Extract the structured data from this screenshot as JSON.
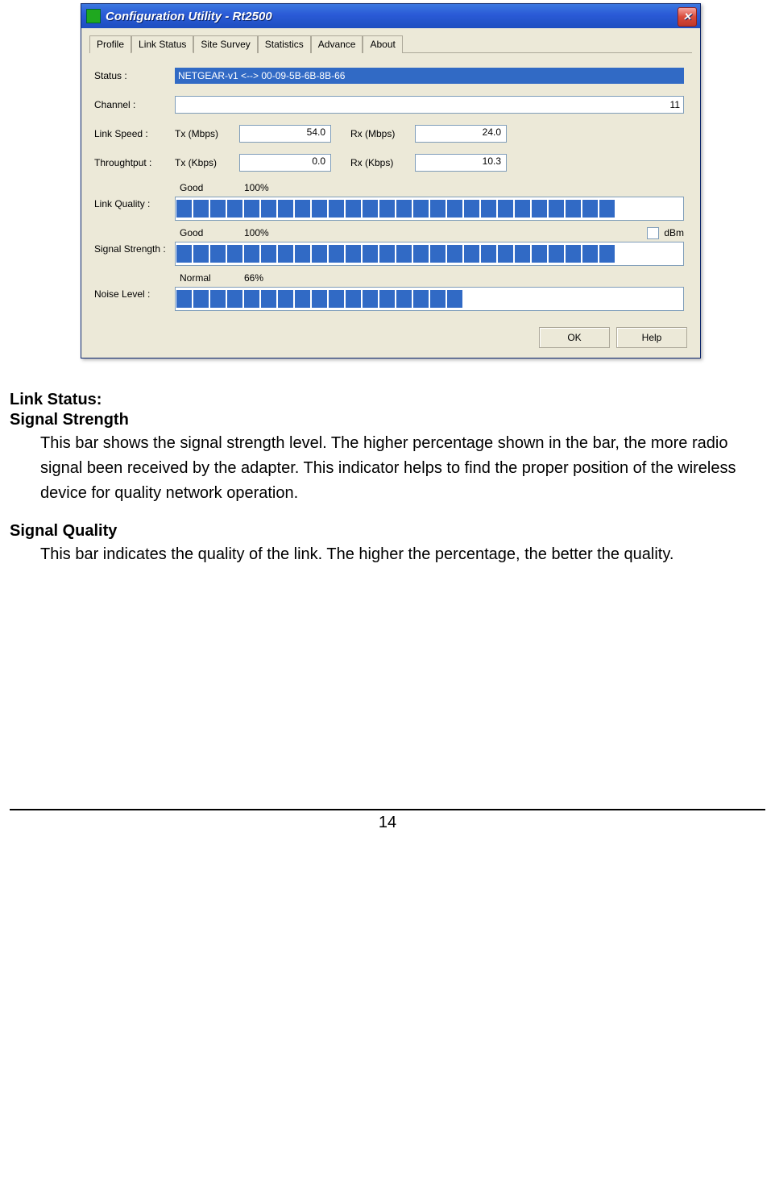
{
  "window": {
    "title": "Configuration Utility - Rt2500",
    "close_glyph": "✕"
  },
  "tabs": [
    "Profile",
    "Link Status",
    "Site Survey",
    "Statistics",
    "Advance",
    "About"
  ],
  "active_tab": 1,
  "fields": {
    "status_label": "Status :",
    "status_value": "NETGEAR-v1 <--> 00-09-5B-6B-8B-66",
    "channel_label": "Channel :",
    "channel_value": "11",
    "linkspeed_label": "Link Speed :",
    "throughput_label": "Throughtput :",
    "tx_mbps_label": "Tx (Mbps)",
    "rx_mbps_label": "Rx (Mbps)",
    "tx_kbps_label": "Tx (Kbps)",
    "rx_kbps_label": "Rx (Kbps)",
    "linkspeed_tx": "54.0",
    "linkspeed_rx": "24.0",
    "throughput_tx": "0.0",
    "throughput_rx": "10.3"
  },
  "meters": {
    "link_quality": {
      "label": "Link Quality :",
      "quality": "Good",
      "percent": "100%",
      "segments": 26
    },
    "signal_strength": {
      "label": "Signal Strength :",
      "quality": "Good",
      "percent": "100%",
      "dbm_label": "dBm",
      "segments": 26
    },
    "noise_level": {
      "label": "Noise Level :",
      "quality": "Normal",
      "percent": "66%",
      "segments": 17
    }
  },
  "buttons": {
    "ok": "OK",
    "help": "Help"
  },
  "doc": {
    "h1": "Link Status:",
    "h2a": "Signal Strength",
    "p1": "This bar shows the signal strength level. The higher percentage shown in the bar, the more radio signal been received by the adapter. This indicator helps to find the proper position of the wireless device for quality network operation.",
    "h2b": "Signal Quality",
    "p2": "This bar indicates the quality of the link. The higher the percentage, the better the quality.",
    "page_number": "14"
  }
}
